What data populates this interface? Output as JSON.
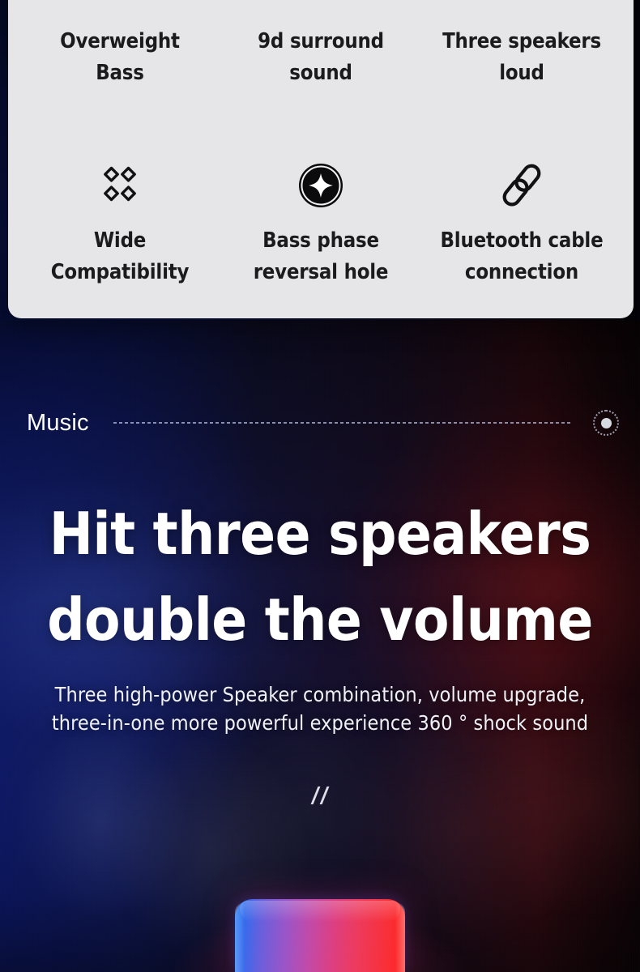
{
  "feature_card": {
    "rows": [
      {
        "cells": [
          {
            "label": "Overweight\nBass",
            "icon": "",
            "icon_visible": false
          },
          {
            "label": "9d surround\nsound",
            "icon": "",
            "icon_visible": false
          },
          {
            "label": "Three speakers\nloud",
            "icon": "",
            "icon_visible": false
          }
        ]
      },
      {
        "cells": [
          {
            "label": "Wide\nCompatibility",
            "icon": "four-petal-clover-icon",
            "icon_visible": true
          },
          {
            "label": "Bass phase\nreversal hole",
            "icon": "diamond-in-circle-icon",
            "icon_visible": true
          },
          {
            "label": "Bluetooth cable\nconnection",
            "icon": "chain-link-icon",
            "icon_visible": true
          }
        ]
      }
    ]
  },
  "section": {
    "title": "Music",
    "rule": "dotted-divider",
    "knob": "dotted-circle-knob"
  },
  "hero": {
    "title": "Hit three speakers\ndouble the volume",
    "subtitle": "Three high-power Speaker combination, volume upgrade,\nthree-in-one more powerful experience 360 ° shock sound",
    "divider": "double-slash-divider"
  },
  "product": {
    "name": "bluetooth-speaker",
    "gradient_start": "#0b6cf5",
    "gradient_mid": "#9a55c8",
    "gradient_end": "#ff2420"
  },
  "colors": {
    "card_bg": "#e6e6e8",
    "card_text": "#1b1b1d",
    "bg_blue": "#102ec6",
    "bg_dark": "#07060f",
    "accent_white": "#ffffff"
  }
}
